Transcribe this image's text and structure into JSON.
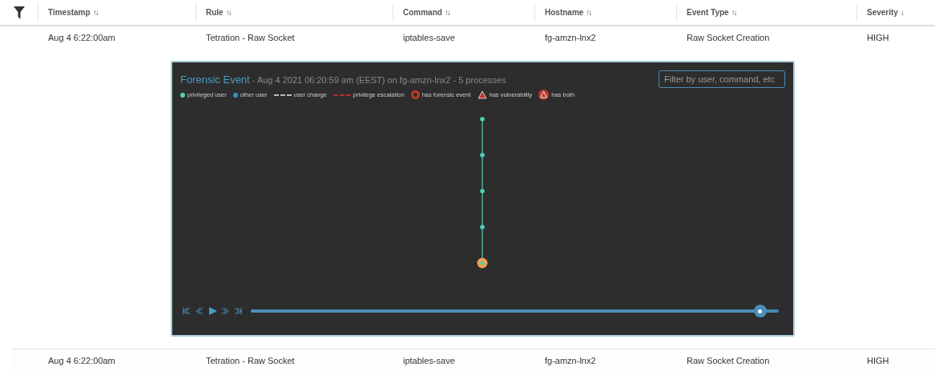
{
  "table": {
    "columns": [
      {
        "label": "Timestamp",
        "sort_icon": "↑↓"
      },
      {
        "label": "Rule",
        "sort_icon": "↑↓"
      },
      {
        "label": "Command",
        "sort_icon": "↑↓"
      },
      {
        "label": "Hostname",
        "sort_icon": "↑↓"
      },
      {
        "label": "Event Type",
        "sort_icon": "↑↓"
      },
      {
        "label": "Severity",
        "sort_icon": "↓"
      }
    ],
    "rows": [
      {
        "cells": [
          "Aug 4 6:22:00am",
          "Tetration - Raw Socket",
          "iptables-save",
          "fg-amzn-lnx2",
          "Raw Socket Creation",
          "HIGH"
        ],
        "expanded": true
      },
      {
        "cells": [
          "Aug 4 6:22:00am",
          "Tetration - Raw Socket",
          "iptables-save",
          "fg-amzn-lnx2",
          "Raw Socket Creation",
          "HIGH"
        ],
        "expanded": false
      }
    ]
  },
  "forensic_panel": {
    "title": "Forensic Event",
    "subtitle": "- Aug 4 2021 06:20:59 am (EEST) on fg-amzn-lnx2 - 5 processes",
    "filter": {
      "placeholder": "Filter by user, command, etc"
    },
    "legend": [
      {
        "kind": "dot",
        "color": "#4fd1b5",
        "label": "privileged user"
      },
      {
        "kind": "dot",
        "color": "#3d8fc4",
        "label": "other user"
      },
      {
        "kind": "dash",
        "color": "#bbbbbb",
        "label": "user change"
      },
      {
        "kind": "dash",
        "color": "#b03030",
        "label": "privilege escalation"
      },
      {
        "kind": "ring",
        "color": "#c0392b",
        "label": "has forensic event"
      },
      {
        "kind": "triangle",
        "color": "#c0392b",
        "label": "has vulnerability"
      },
      {
        "kind": "both",
        "color": "#c0392b",
        "label": "has both"
      }
    ],
    "processes": [
      {
        "kind": "privileged"
      },
      {
        "kind": "privileged"
      },
      {
        "kind": "privileged"
      },
      {
        "kind": "privileged"
      },
      {
        "kind": "current"
      }
    ],
    "timeline": {
      "level": 0.965
    }
  }
}
